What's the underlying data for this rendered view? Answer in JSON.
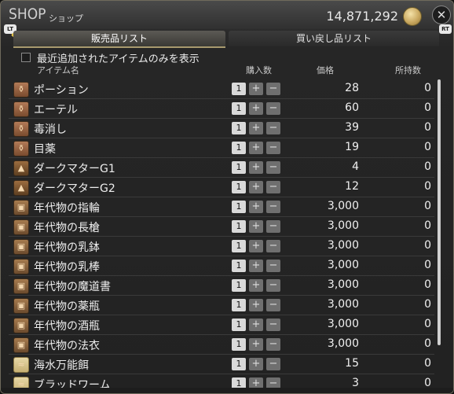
{
  "header": {
    "title": "SHOP",
    "subtitle": "ショップ",
    "gil": "14,871,292",
    "lt": "LT",
    "rt": "RT"
  },
  "tabs": {
    "sell": "販売品リスト",
    "buyback": "買い戻し品リスト"
  },
  "filter": {
    "label": "最近追加されたアイテムのみを表示",
    "checked": false
  },
  "columns": {
    "item": "アイテム名",
    "buy_qty": "購入数",
    "price": "価格",
    "owned": "所持数"
  },
  "items": [
    {
      "name": "ポーション",
      "qty": "1",
      "price": "28",
      "owned": "0",
      "icon": "potion-icon"
    },
    {
      "name": "エーテル",
      "qty": "1",
      "price": "60",
      "owned": "0",
      "icon": "potion-icon"
    },
    {
      "name": "毒消し",
      "qty": "1",
      "price": "39",
      "owned": "0",
      "icon": "potion-icon"
    },
    {
      "name": "目薬",
      "qty": "1",
      "price": "19",
      "owned": "0",
      "icon": "potion-icon"
    },
    {
      "name": "ダークマターG1",
      "qty": "1",
      "price": "4",
      "owned": "0",
      "icon": "dark-matter-icon"
    },
    {
      "name": "ダークマターG2",
      "qty": "1",
      "price": "12",
      "owned": "0",
      "icon": "dark-matter-icon"
    },
    {
      "name": "年代物の指輪",
      "qty": "1",
      "price": "3,000",
      "owned": "0",
      "icon": "chest-icon"
    },
    {
      "name": "年代物の長槍",
      "qty": "1",
      "price": "3,000",
      "owned": "0",
      "icon": "chest-icon"
    },
    {
      "name": "年代物の乳鉢",
      "qty": "1",
      "price": "3,000",
      "owned": "0",
      "icon": "chest-icon"
    },
    {
      "name": "年代物の乳棒",
      "qty": "1",
      "price": "3,000",
      "owned": "0",
      "icon": "chest-icon"
    },
    {
      "name": "年代物の魔道書",
      "qty": "1",
      "price": "3,000",
      "owned": "0",
      "icon": "chest-icon"
    },
    {
      "name": "年代物の薬瓶",
      "qty": "1",
      "price": "3,000",
      "owned": "0",
      "icon": "chest-icon"
    },
    {
      "name": "年代物の酒瓶",
      "qty": "1",
      "price": "3,000",
      "owned": "0",
      "icon": "chest-icon"
    },
    {
      "name": "年代物の法衣",
      "qty": "1",
      "price": "3,000",
      "owned": "0",
      "icon": "chest-icon"
    },
    {
      "name": "海水万能餌",
      "qty": "1",
      "price": "15",
      "owned": "0",
      "icon": "bait-icon"
    },
    {
      "name": "ブラッドワーム",
      "qty": "1",
      "price": "3",
      "owned": "0",
      "icon": "bait-icon"
    }
  ]
}
